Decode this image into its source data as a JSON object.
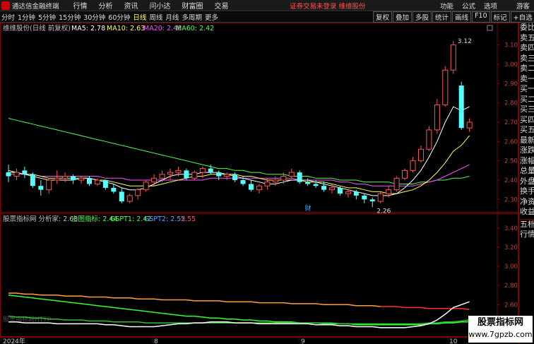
{
  "menu": {
    "app_title": "通达信金融终端",
    "items": [
      "行情",
      "分析",
      "资讯",
      "问小达",
      "财富圈",
      "交易"
    ],
    "login_status": "证券交易未登录",
    "broker": "维维股份",
    "right_items": [
      "功能",
      "公式",
      "选项"
    ],
    "guest": "游客"
  },
  "toolbar": {
    "periods": [
      "分时",
      "1分钟",
      "5分钟",
      "15分钟",
      "30分钟",
      "60分钟",
      "日线",
      "周线",
      "月线",
      "多周期",
      "更多"
    ],
    "active_period": "日线",
    "tools": [
      "复权",
      "叠加",
      "多股",
      "统计",
      "画线",
      "F10",
      "标记",
      "+自选"
    ]
  },
  "main_chart": {
    "title": "维维股份(日线 前复权)",
    "ma": [
      {
        "label": "MA5: 2.78",
        "color": "#ffffff"
      },
      {
        "label": "MA10: 2.63",
        "color": "#ffff54"
      },
      {
        "label": "MA20: 2.48",
        "color": "#ff54ff"
      },
      {
        "label": "MA60: 2.42",
        "color": "#54ff54"
      }
    ],
    "high_label": "3.12",
    "low_label": "2.26",
    "event_label": "财",
    "y_ticks": [
      "3.10",
      "3.00",
      "2.90",
      "2.80",
      "2.70",
      "2.60",
      "2.50",
      "2.40",
      "2.30"
    ]
  },
  "indicator": {
    "title": "股票指标网 分析家: 2.63",
    "values": [
      {
        "label": "主图指标: 2.44",
        "color": "#54ff54"
      },
      {
        "label": "GSPT1: 2.42",
        "color": "#54ff54"
      },
      {
        "label": "GSPT2: 2.55",
        "color": "#54a8ff"
      },
      {
        "label": "2.55",
        "color": "#ff5454"
      }
    ],
    "watermark_text": "股票指标网HTTP",
    "y_ticks": [
      "3.40",
      "3.20",
      "3.00",
      "2.80",
      "2.60",
      "2.40"
    ]
  },
  "x_axis": {
    "labels": [
      "2024年",
      "8",
      "9",
      "10"
    ]
  },
  "side_panel": {
    "items": [
      "委比",
      "卖五",
      "卖四",
      "卖三",
      "卖二",
      "卖一",
      "买一",
      "买二",
      "买三",
      "买四",
      "买五",
      "最新",
      "涨跌",
      "涨幅",
      "总量",
      "外盘",
      "换手",
      "净资",
      "收益"
    ],
    "items2": [
      "五档",
      "行情"
    ]
  },
  "watermark": {
    "line1": "股票指标网",
    "line2": "www.7gpzb.com"
  },
  "chart_data": {
    "type": "candlestick",
    "ylim": [
      2.25,
      3.15
    ],
    "candles": [
      [
        2.44,
        2.48,
        2.39,
        2.42
      ],
      [
        2.42,
        2.46,
        2.4,
        2.44
      ],
      [
        2.45,
        2.47,
        2.41,
        2.43
      ],
      [
        2.43,
        2.44,
        2.36,
        2.37
      ],
      [
        2.37,
        2.4,
        2.32,
        2.35
      ],
      [
        2.35,
        2.41,
        2.33,
        2.4
      ],
      [
        2.4,
        2.45,
        2.38,
        2.41
      ],
      [
        2.41,
        2.44,
        2.39,
        2.42
      ],
      [
        2.42,
        2.43,
        2.38,
        2.4
      ],
      [
        2.4,
        2.42,
        2.38,
        2.41
      ],
      [
        2.41,
        2.42,
        2.37,
        2.38
      ],
      [
        2.38,
        2.41,
        2.37,
        2.4
      ],
      [
        2.4,
        2.4,
        2.35,
        2.36
      ],
      [
        2.36,
        2.38,
        2.33,
        2.34
      ],
      [
        2.34,
        2.36,
        2.28,
        2.29
      ],
      [
        2.29,
        2.33,
        2.28,
        2.32
      ],
      [
        2.32,
        2.36,
        2.3,
        2.35
      ],
      [
        2.35,
        2.4,
        2.34,
        2.39
      ],
      [
        2.39,
        2.43,
        2.37,
        2.41
      ],
      [
        2.41,
        2.45,
        2.39,
        2.43
      ],
      [
        2.43,
        2.46,
        2.4,
        2.44
      ],
      [
        2.44,
        2.47,
        2.42,
        2.45
      ],
      [
        2.45,
        2.46,
        2.4,
        2.41
      ],
      [
        2.41,
        2.45,
        2.4,
        2.44
      ],
      [
        2.44,
        2.47,
        2.41,
        2.46
      ],
      [
        2.46,
        2.48,
        2.43,
        2.44
      ],
      [
        2.44,
        2.45,
        2.4,
        2.42
      ],
      [
        2.42,
        2.44,
        2.4,
        2.43
      ],
      [
        2.43,
        2.44,
        2.39,
        2.4
      ],
      [
        2.4,
        2.42,
        2.37,
        2.38
      ],
      [
        2.38,
        2.4,
        2.34,
        2.35
      ],
      [
        2.35,
        2.38,
        2.33,
        2.37
      ],
      [
        2.37,
        2.41,
        2.35,
        2.39
      ],
      [
        2.39,
        2.42,
        2.37,
        2.4
      ],
      [
        2.4,
        2.44,
        2.38,
        2.42
      ],
      [
        2.42,
        2.46,
        2.41,
        2.44
      ],
      [
        2.44,
        2.45,
        2.38,
        2.39
      ],
      [
        2.39,
        2.41,
        2.37,
        2.38
      ],
      [
        2.38,
        2.4,
        2.36,
        2.37
      ],
      [
        2.37,
        2.39,
        2.34,
        2.35
      ],
      [
        2.35,
        2.38,
        2.33,
        2.36
      ],
      [
        2.36,
        2.37,
        2.32,
        2.33
      ],
      [
        2.33,
        2.35,
        2.31,
        2.34
      ],
      [
        2.34,
        2.35,
        2.3,
        2.32
      ],
      [
        2.32,
        2.33,
        2.28,
        2.3
      ],
      [
        2.3,
        2.31,
        2.26,
        2.29
      ],
      [
        2.29,
        2.34,
        2.28,
        2.33
      ],
      [
        2.33,
        2.37,
        2.31,
        2.35
      ],
      [
        2.35,
        2.42,
        2.34,
        2.41
      ],
      [
        2.41,
        2.46,
        2.4,
        2.45
      ],
      [
        2.45,
        2.52,
        2.44,
        2.5
      ],
      [
        2.5,
        2.58,
        2.49,
        2.56
      ],
      [
        2.56,
        2.68,
        2.55,
        2.66
      ],
      [
        2.66,
        2.82,
        2.64,
        2.79
      ],
      [
        2.79,
        2.99,
        2.78,
        2.97
      ],
      [
        2.97,
        3.12,
        2.95,
        3.1
      ],
      [
        2.89,
        2.91,
        2.66,
        2.67
      ],
      [
        2.67,
        2.72,
        2.65,
        2.7
      ]
    ],
    "ma5": [
      2.45,
      2.44,
      2.43,
      2.42,
      2.41,
      2.4,
      2.4,
      2.4,
      2.4,
      2.41,
      2.41,
      2.4,
      2.39,
      2.38,
      2.36,
      2.35,
      2.35,
      2.36,
      2.38,
      2.4,
      2.42,
      2.43,
      2.43,
      2.43,
      2.44,
      2.44,
      2.44,
      2.43,
      2.42,
      2.41,
      2.4,
      2.39,
      2.38,
      2.38,
      2.39,
      2.4,
      2.4,
      2.4,
      2.39,
      2.38,
      2.37,
      2.36,
      2.35,
      2.34,
      2.33,
      2.32,
      2.32,
      2.32,
      2.33,
      2.36,
      2.4,
      2.45,
      2.52,
      2.6,
      2.7,
      2.78,
      2.76,
      2.78
    ],
    "ma10": [
      2.44,
      2.44,
      2.43,
      2.43,
      2.42,
      2.41,
      2.41,
      2.41,
      2.41,
      2.41,
      2.41,
      2.4,
      2.4,
      2.39,
      2.38,
      2.37,
      2.37,
      2.37,
      2.37,
      2.38,
      2.39,
      2.4,
      2.41,
      2.42,
      2.42,
      2.43,
      2.43,
      2.43,
      2.43,
      2.42,
      2.42,
      2.41,
      2.4,
      2.4,
      2.4,
      2.4,
      2.4,
      2.39,
      2.39,
      2.39,
      2.38,
      2.37,
      2.36,
      2.36,
      2.35,
      2.34,
      2.34,
      2.33,
      2.33,
      2.34,
      2.35,
      2.37,
      2.4,
      2.44,
      2.49,
      2.55,
      2.58,
      2.63
    ],
    "ma20": [
      2.43,
      2.43,
      2.43,
      2.43,
      2.42,
      2.42,
      2.42,
      2.42,
      2.42,
      2.42,
      2.42,
      2.42,
      2.41,
      2.41,
      2.41,
      2.4,
      2.4,
      2.4,
      2.4,
      2.4,
      2.4,
      2.4,
      2.4,
      2.4,
      2.4,
      2.41,
      2.41,
      2.41,
      2.41,
      2.41,
      2.41,
      2.41,
      2.41,
      2.41,
      2.41,
      2.41,
      2.4,
      2.4,
      2.4,
      2.4,
      2.4,
      2.39,
      2.39,
      2.38,
      2.38,
      2.37,
      2.37,
      2.37,
      2.37,
      2.37,
      2.37,
      2.38,
      2.39,
      2.4,
      2.42,
      2.44,
      2.46,
      2.48
    ],
    "ma60": [
      2.72,
      2.71,
      2.7,
      2.69,
      2.68,
      2.67,
      2.66,
      2.65,
      2.64,
      2.63,
      2.62,
      2.61,
      2.6,
      2.59,
      2.58,
      2.57,
      2.56,
      2.55,
      2.54,
      2.53,
      2.52,
      2.51,
      2.5,
      2.49,
      2.48,
      2.47,
      2.46,
      2.46,
      2.45,
      2.45,
      2.44,
      2.44,
      2.43,
      2.43,
      2.43,
      2.42,
      2.42,
      2.42,
      2.41,
      2.41,
      2.41,
      2.4,
      2.4,
      2.4,
      2.39,
      2.39,
      2.39,
      2.39,
      2.38,
      2.38,
      2.38,
      2.39,
      2.39,
      2.4,
      2.4,
      2.41,
      2.41,
      2.42
    ],
    "ind_ylim": [
      2.3,
      3.45
    ],
    "ind_orange": [
      2.72,
      2.72,
      2.71,
      2.71,
      2.7,
      2.7,
      2.7,
      2.69,
      2.69,
      2.69,
      2.68,
      2.68,
      2.68,
      2.67,
      2.67,
      2.67,
      2.66,
      2.66,
      2.66,
      2.65,
      2.65,
      2.65,
      2.65,
      2.64,
      2.64,
      2.64,
      2.64,
      2.63,
      2.63,
      2.63,
      2.63,
      2.62,
      2.62,
      2.62,
      2.62,
      2.61,
      2.61,
      2.61,
      2.61,
      2.6,
      2.6,
      2.6,
      2.6,
      2.59,
      2.59,
      2.59,
      2.58,
      2.58,
      2.58,
      2.57,
      2.57,
      2.57,
      2.56,
      2.56,
      2.56,
      2.56,
      2.56,
      2.55
    ],
    "ind_green1": [
      2.7,
      2.69,
      2.68,
      2.67,
      2.66,
      2.65,
      2.64,
      2.63,
      2.62,
      2.61,
      2.6,
      2.59,
      2.58,
      2.57,
      2.56,
      2.55,
      2.54,
      2.53,
      2.52,
      2.51,
      2.5,
      2.49,
      2.48,
      2.48,
      2.47,
      2.46,
      2.46,
      2.45,
      2.45,
      2.44,
      2.44,
      2.43,
      2.43,
      2.42,
      2.42,
      2.42,
      2.41,
      2.41,
      2.41,
      2.4,
      2.4,
      2.4,
      2.4,
      2.39,
      2.39,
      2.39,
      2.39,
      2.39,
      2.39,
      2.39,
      2.39,
      2.39,
      2.4,
      2.4,
      2.41,
      2.41,
      2.42,
      2.42
    ],
    "ind_green2": [
      2.48,
      2.47,
      2.47,
      2.46,
      2.46,
      2.45,
      2.45,
      2.44,
      2.44,
      2.44,
      2.43,
      2.43,
      2.43,
      2.42,
      2.42,
      2.42,
      2.42,
      2.41,
      2.41,
      2.41,
      2.41,
      2.41,
      2.41,
      2.41,
      2.41,
      2.41,
      2.41,
      2.41,
      2.41,
      2.41,
      2.41,
      2.41,
      2.41,
      2.41,
      2.41,
      2.41,
      2.41,
      2.41,
      2.41,
      2.41,
      2.41,
      2.4,
      2.4,
      2.4,
      2.4,
      2.4,
      2.4,
      2.4,
      2.4,
      2.4,
      2.4,
      2.4,
      2.41,
      2.41,
      2.42,
      2.42,
      2.43,
      2.44
    ],
    "ind_white": [
      2.42,
      2.42,
      2.41,
      2.41,
      2.41,
      2.41,
      2.4,
      2.4,
      2.4,
      2.4,
      2.4,
      2.4,
      2.39,
      2.39,
      2.38,
      2.37,
      2.37,
      2.37,
      2.37,
      2.38,
      2.39,
      2.4,
      2.4,
      2.41,
      2.41,
      2.42,
      2.42,
      2.42,
      2.41,
      2.41,
      2.41,
      2.4,
      2.4,
      2.4,
      2.4,
      2.4,
      2.4,
      2.4,
      2.39,
      2.39,
      2.39,
      2.38,
      2.38,
      2.37,
      2.37,
      2.37,
      2.36,
      2.36,
      2.36,
      2.36,
      2.37,
      2.38,
      2.4,
      2.44,
      2.5,
      2.57,
      2.6,
      2.63
    ]
  }
}
